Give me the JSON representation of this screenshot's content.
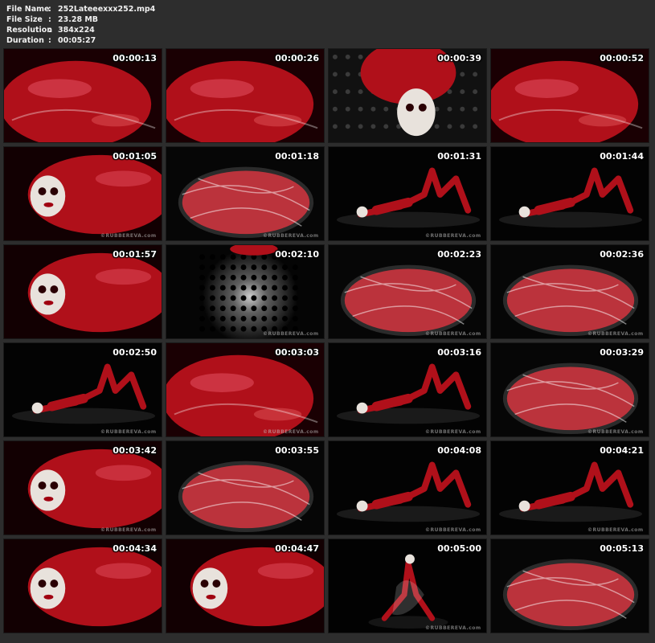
{
  "info": {
    "file_name_label": "File Name",
    "file_name": "252Lateeexxx252.mp4",
    "file_size_label": "File Size",
    "file_size": "23.28 MB",
    "resolution_label": "Resolution",
    "resolution": "384x224",
    "duration_label": "Duration",
    "duration": "00:05:27",
    "separator": ":"
  },
  "watermark": "©RUBBEREVA.com",
  "thumbnails": [
    {
      "time": "00:00:13",
      "scene": "closeup",
      "watermark": false
    },
    {
      "time": "00:00:26",
      "scene": "closeup",
      "watermark": false
    },
    {
      "time": "00:00:39",
      "scene": "mask-grid",
      "watermark": false
    },
    {
      "time": "00:00:52",
      "scene": "closeup",
      "watermark": false
    },
    {
      "time": "00:01:05",
      "scene": "mask",
      "watermark": true
    },
    {
      "time": "00:01:18",
      "scene": "wrapped",
      "watermark": true
    },
    {
      "time": "00:01:31",
      "scene": "lying",
      "watermark": true
    },
    {
      "time": "00:01:44",
      "scene": "lying",
      "watermark": false
    },
    {
      "time": "00:01:57",
      "scene": "mask",
      "watermark": false
    },
    {
      "time": "00:02:10",
      "scene": "light",
      "watermark": true
    },
    {
      "time": "00:02:23",
      "scene": "wrapped",
      "watermark": true
    },
    {
      "time": "00:02:36",
      "scene": "wrapped",
      "watermark": true
    },
    {
      "time": "00:02:50",
      "scene": "lying",
      "watermark": true
    },
    {
      "time": "00:03:03",
      "scene": "closeup",
      "watermark": true
    },
    {
      "time": "00:03:16",
      "scene": "lying",
      "watermark": true
    },
    {
      "time": "00:03:29",
      "scene": "wrapped",
      "watermark": true
    },
    {
      "time": "00:03:42",
      "scene": "mask",
      "watermark": true
    },
    {
      "time": "00:03:55",
      "scene": "wrapped",
      "watermark": false
    },
    {
      "time": "00:04:08",
      "scene": "lying",
      "watermark": true
    },
    {
      "time": "00:04:21",
      "scene": "lying",
      "watermark": true
    },
    {
      "time": "00:04:34",
      "scene": "mask",
      "watermark": false
    },
    {
      "time": "00:04:47",
      "scene": "mask",
      "watermark": false
    },
    {
      "time": "00:05:00",
      "scene": "sitting",
      "watermark": true
    },
    {
      "time": "00:05:13",
      "scene": "wrapped",
      "watermark": false
    }
  ],
  "colors": {
    "background": "#2d2d2d",
    "latex_red": "#b0101a",
    "mask_white": "#e8e2dc"
  }
}
